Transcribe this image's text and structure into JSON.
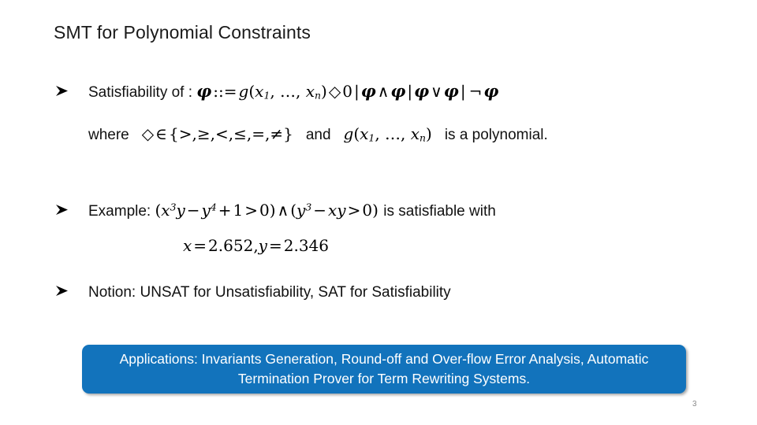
{
  "slide": {
    "title": "SMT for Polynomial Constraints",
    "page_number": "3",
    "bullet_marker_icon": "arrowhead-bullet-icon",
    "accent_color": "#1273BC",
    "text_color": "#111111"
  },
  "bullets": [
    {
      "id": "satisfiability",
      "label": "Satisfiability of :",
      "formula_plain": "φ ::= g(x₁, …, xₙ) ◇ 0 | φ ∧ φ | φ ∨ φ | ¬φ",
      "formula_parts": {
        "phi": "φ",
        "defines": "::=",
        "g": "g",
        "open_paren": "(",
        "x": "x",
        "sub_one": "1",
        "ellipsis": ", …, ",
        "sub_n": "n",
        "close_paren": ")",
        "diamond": "◇",
        "zero": "0",
        "bar": "|",
        "and": "∧",
        "or": "∨",
        "not": "¬"
      }
    },
    {
      "id": "example",
      "label": "Example:",
      "formula_plain": "(x³y − y⁴ + 1 > 0) ∧ (y³ − xy > 0)",
      "trailing_text": "is satisfiable with",
      "solution_plain": "x = 2.652, y = 2.346",
      "solution": {
        "x_var": "x",
        "x_value": "2.652",
        "y_var": "y",
        "y_value": "2.346",
        "equals": "=",
        "comma": ","
      }
    },
    {
      "id": "notion",
      "label": "Notion: UNSAT for Unsatisfiability, SAT for Satisfiability"
    }
  ],
  "where_line": {
    "where_label": "where",
    "diamond": "◇",
    "member_of": "∈",
    "set_plain": "{>, ≥, <, ≤, =, ≠}",
    "set_open": "{",
    "set_items": [
      ">",
      "≥",
      "<",
      "≤",
      "=",
      "≠"
    ],
    "set_close": "}",
    "and_label": "and",
    "g_function_plain": "g(x₁, …, xₙ)",
    "tail_label": "is a polynomial."
  },
  "applications_box": {
    "text": "Applications: Invariants Generation, Round-off and Over-flow Error Analysis, Automatic Termination Prover for Term Rewriting Systems.",
    "background_color": "#1273BC",
    "text_color": "#FFFFFF"
  }
}
